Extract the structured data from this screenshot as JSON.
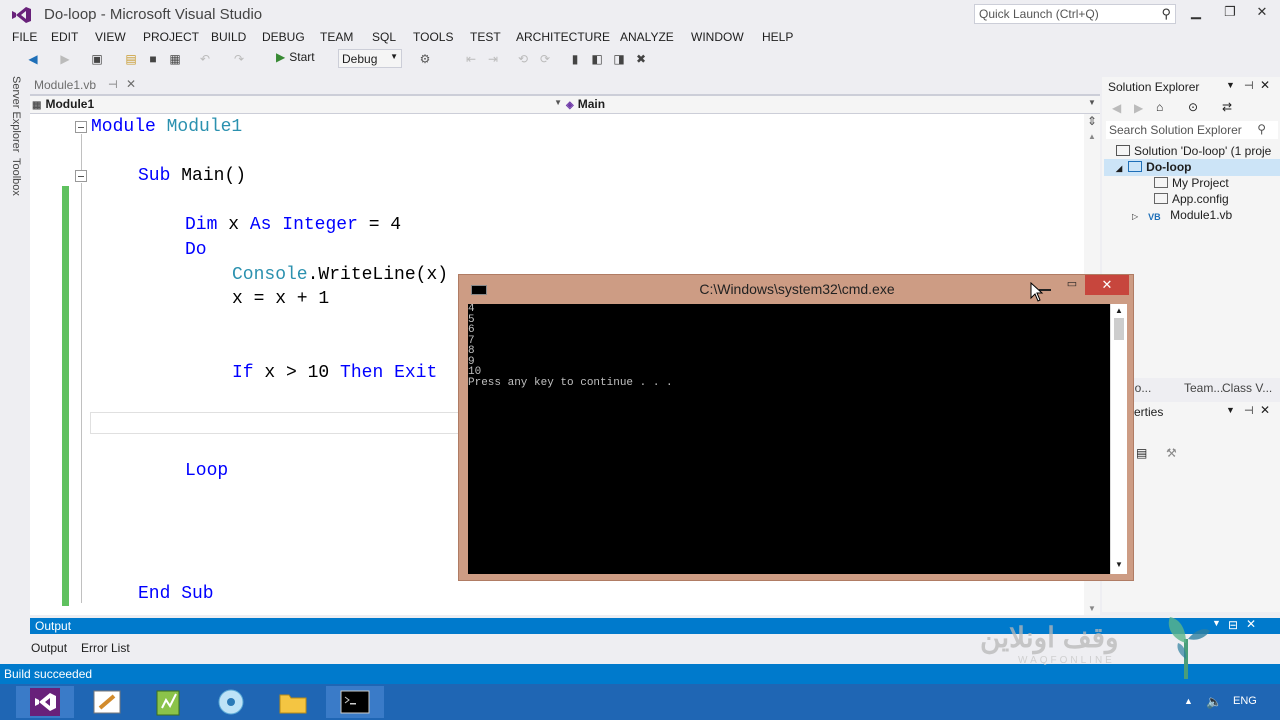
{
  "window": {
    "title": "Do-loop - Microsoft Visual Studio",
    "quick_launch_placeholder": "Quick Launch (Ctrl+Q)"
  },
  "menu": [
    "FILE",
    "EDIT",
    "VIEW",
    "PROJECT",
    "BUILD",
    "DEBUG",
    "TEAM",
    "SQL",
    "TOOLS",
    "TEST",
    "ARCHITECTURE",
    "ANALYZE",
    "WINDOW",
    "HELP"
  ],
  "toolbar": {
    "start_label": "Start",
    "config_value": "Debug"
  },
  "left_strip": {
    "server_explorer": "Server Explorer",
    "toolbox": "Toolbox"
  },
  "document_tab": {
    "label": "Module1.vb"
  },
  "nav_bar": {
    "left": "Module1",
    "right": "Main"
  },
  "code": {
    "module_decl": {
      "kw": "Module",
      "name": "Module1"
    },
    "sub_decl": {
      "kw": "Sub",
      "rest": "Main()"
    },
    "dim_line": {
      "dim": "Dim",
      "var": "x",
      "as": "As",
      "type": "Integer",
      "rest": "= 4"
    },
    "do_line": "Do",
    "console_line": {
      "type": "Console",
      "rest": ".WriteLine(x)"
    },
    "assign_line": "x = x + 1",
    "if_line": {
      "if": "If",
      "cond": "x > 10",
      "then": "Then",
      "exit": "Exit"
    },
    "loop_line": "Loop",
    "end_sub_line": "End Sub"
  },
  "cmd": {
    "title": "C:\\Windows\\system32\\cmd.exe",
    "close": "✕",
    "output": "4\n5\n6\n7\n8\n9\n10\nPress any key to continue . . ."
  },
  "solution_explorer": {
    "title": "Solution Explorer",
    "search_placeholder": "Search Solution Explorer",
    "items": [
      {
        "label": "Solution 'Do-loop' (1 proje"
      },
      {
        "label": "Do-loop"
      },
      {
        "label": "My Project"
      },
      {
        "label": "App.config"
      },
      {
        "label": "Module1.vb"
      }
    ],
    "tabs": [
      "io...",
      "Team...",
      "Class V..."
    ],
    "properties_head": "erties"
  },
  "output_panel": {
    "header": "Output",
    "tabs": [
      "Output",
      "Error List"
    ]
  },
  "status": {
    "text": "Build succeeded"
  },
  "taskbar": {
    "language": "ENG"
  },
  "watermark": {
    "text": "وقف اونلاين",
    "sub": "WAQFONLINE"
  }
}
